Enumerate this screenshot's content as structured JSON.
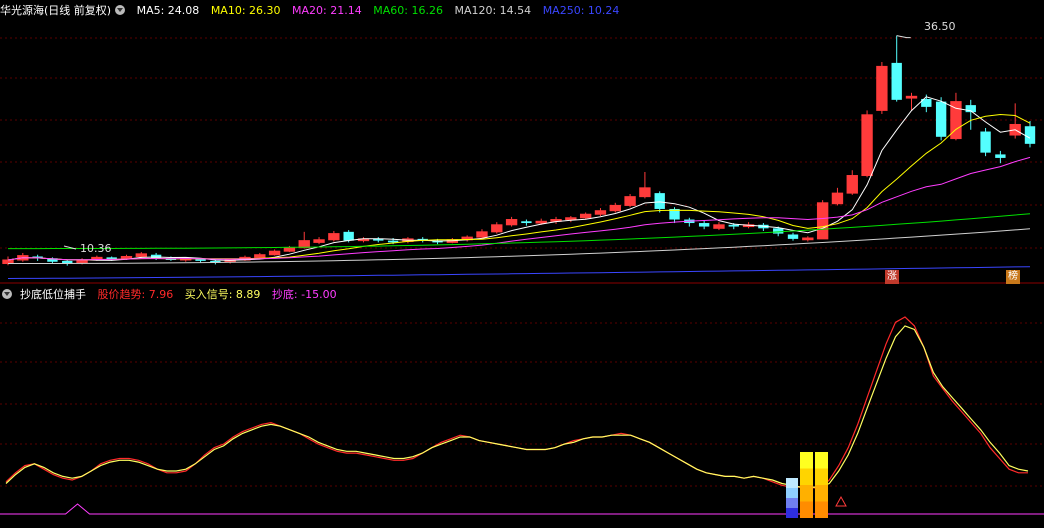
{
  "main_header": {
    "title": "华光源海(日线 前复权)",
    "items": [
      {
        "label": "MA5: 24.08",
        "color": "#ffffff"
      },
      {
        "label": "MA10: 26.30",
        "color": "#ffff00"
      },
      {
        "label": "MA20: 21.14",
        "color": "#ff3dff"
      },
      {
        "label": "MA60: 16.26",
        "color": "#00e000"
      },
      {
        "label": "MA120: 14.54",
        "color": "#d0d0d0"
      },
      {
        "label": "MA250: 10.24",
        "color": "#3a46ff"
      }
    ]
  },
  "sub_header": {
    "title": "抄底低位捕手",
    "items": [
      {
        "label": "股价趋势: 7.96",
        "color": "#ff2a2a"
      },
      {
        "label": "买入信号: 8.89",
        "color": "#ffff60"
      },
      {
        "label": "抄底: -15.00",
        "color": "#ff3dff"
      }
    ]
  },
  "annotations": {
    "high": "36.50",
    "low": "10.36"
  },
  "tags": [
    {
      "text": "涨",
      "bg": "#c0392b"
    },
    {
      "text": "榜",
      "bg": "#c8781a"
    }
  ],
  "colors": {
    "up": "#ff3b3b",
    "down": "#54ffff",
    "grid": "#5a0000",
    "bg": "#000000"
  },
  "chart_data": [
    {
      "type": "candlestick",
      "note": "daily candles, price axis",
      "candles": [
        {
          "o": 10.6,
          "c": 11.0,
          "h": 11.4,
          "l": 10.4
        },
        {
          "o": 11.0,
          "c": 11.5,
          "h": 11.8,
          "l": 10.8
        },
        {
          "o": 11.4,
          "c": 11.2,
          "h": 11.6,
          "l": 10.9
        },
        {
          "o": 11.2,
          "c": 10.8,
          "h": 11.3,
          "l": 10.6
        },
        {
          "o": 10.9,
          "c": 10.6,
          "h": 11.0,
          "l": 10.36
        },
        {
          "o": 10.7,
          "c": 11.0,
          "h": 11.2,
          "l": 10.5
        },
        {
          "o": 11.0,
          "c": 11.3,
          "h": 11.5,
          "l": 10.9
        },
        {
          "o": 11.3,
          "c": 11.1,
          "h": 11.4,
          "l": 10.9
        },
        {
          "o": 11.2,
          "c": 11.4,
          "h": 11.6,
          "l": 11.0
        },
        {
          "o": 11.4,
          "c": 11.7,
          "h": 11.9,
          "l": 11.2
        },
        {
          "o": 11.6,
          "c": 11.2,
          "h": 11.8,
          "l": 11.0
        },
        {
          "o": 11.2,
          "c": 11.0,
          "h": 11.4,
          "l": 10.9
        },
        {
          "o": 11.0,
          "c": 11.2,
          "h": 11.3,
          "l": 10.8
        },
        {
          "o": 11.1,
          "c": 10.9,
          "h": 11.2,
          "l": 10.7
        },
        {
          "o": 10.9,
          "c": 10.7,
          "h": 11.0,
          "l": 10.5
        },
        {
          "o": 10.8,
          "c": 11.0,
          "h": 11.1,
          "l": 10.6
        },
        {
          "o": 11.0,
          "c": 11.3,
          "h": 11.5,
          "l": 10.9
        },
        {
          "o": 11.3,
          "c": 11.6,
          "h": 11.8,
          "l": 11.2
        },
        {
          "o": 11.6,
          "c": 12.0,
          "h": 12.2,
          "l": 11.5
        },
        {
          "o": 12.0,
          "c": 12.4,
          "h": 12.6,
          "l": 11.9
        },
        {
          "o": 12.4,
          "c": 13.2,
          "h": 14.2,
          "l": 12.3
        },
        {
          "o": 13.0,
          "c": 13.3,
          "h": 13.6,
          "l": 12.8
        },
        {
          "o": 13.3,
          "c": 14.0,
          "h": 14.3,
          "l": 13.1
        },
        {
          "o": 14.2,
          "c": 13.2,
          "h": 14.4,
          "l": 13.0
        },
        {
          "o": 13.2,
          "c": 13.4,
          "h": 13.6,
          "l": 13.0
        },
        {
          "o": 13.4,
          "c": 13.2,
          "h": 13.6,
          "l": 13.0
        },
        {
          "o": 13.2,
          "c": 13.0,
          "h": 13.5,
          "l": 12.8
        },
        {
          "o": 13.1,
          "c": 13.4,
          "h": 13.6,
          "l": 12.9
        },
        {
          "o": 13.4,
          "c": 13.2,
          "h": 13.6,
          "l": 13.0
        },
        {
          "o": 13.2,
          "c": 13.0,
          "h": 13.4,
          "l": 12.8
        },
        {
          "o": 13.0,
          "c": 13.3,
          "h": 13.5,
          "l": 12.9
        },
        {
          "o": 13.3,
          "c": 13.6,
          "h": 13.8,
          "l": 13.1
        },
        {
          "o": 13.6,
          "c": 14.2,
          "h": 14.5,
          "l": 13.5
        },
        {
          "o": 14.2,
          "c": 15.0,
          "h": 15.3,
          "l": 14.0
        },
        {
          "o": 15.0,
          "c": 15.6,
          "h": 15.9,
          "l": 14.8
        },
        {
          "o": 15.4,
          "c": 15.2,
          "h": 15.6,
          "l": 14.9
        },
        {
          "o": 15.2,
          "c": 15.4,
          "h": 15.7,
          "l": 15.0
        },
        {
          "o": 15.4,
          "c": 15.6,
          "h": 15.9,
          "l": 15.1
        },
        {
          "o": 15.6,
          "c": 15.8,
          "h": 16.0,
          "l": 15.3
        },
        {
          "o": 15.8,
          "c": 16.2,
          "h": 16.4,
          "l": 15.6
        },
        {
          "o": 16.2,
          "c": 16.6,
          "h": 16.9,
          "l": 16.0
        },
        {
          "o": 16.6,
          "c": 17.2,
          "h": 17.5,
          "l": 16.4
        },
        {
          "o": 17.2,
          "c": 18.2,
          "h": 18.5,
          "l": 17.0
        },
        {
          "o": 18.2,
          "c": 19.2,
          "h": 21.0,
          "l": 18.0
        },
        {
          "o": 18.6,
          "c": 16.8,
          "h": 18.8,
          "l": 16.4
        },
        {
          "o": 16.8,
          "c": 15.6,
          "h": 17.0,
          "l": 15.2
        },
        {
          "o": 15.6,
          "c": 15.2,
          "h": 15.8,
          "l": 14.8
        },
        {
          "o": 15.2,
          "c": 14.8,
          "h": 15.5,
          "l": 14.5
        },
        {
          "o": 14.6,
          "c": 15.0,
          "h": 15.3,
          "l": 14.4
        },
        {
          "o": 15.0,
          "c": 14.8,
          "h": 15.2,
          "l": 14.5
        },
        {
          "o": 14.8,
          "c": 15.0,
          "h": 15.3,
          "l": 14.6
        },
        {
          "o": 15.0,
          "c": 14.6,
          "h": 15.2,
          "l": 14.3
        },
        {
          "o": 14.6,
          "c": 14.0,
          "h": 14.8,
          "l": 13.7
        },
        {
          "o": 13.9,
          "c": 13.4,
          "h": 14.1,
          "l": 13.2
        },
        {
          "o": 13.3,
          "c": 13.5,
          "h": 13.7,
          "l": 13.1
        },
        {
          "o": 13.4,
          "c": 17.5,
          "h": 17.8,
          "l": 13.4
        },
        {
          "o": 17.4,
          "c": 18.6,
          "h": 19.2,
          "l": 17.2
        },
        {
          "o": 18.6,
          "c": 20.6,
          "h": 21.2,
          "l": 18.4
        },
        {
          "o": 20.6,
          "c": 27.5,
          "h": 28.0,
          "l": 20.4
        },
        {
          "o": 28.0,
          "c": 33.0,
          "h": 33.5,
          "l": 27.6
        },
        {
          "o": 33.4,
          "c": 29.2,
          "h": 36.5,
          "l": 29.0
        },
        {
          "o": 29.4,
          "c": 29.6,
          "h": 30.0,
          "l": 28.0
        },
        {
          "o": 29.3,
          "c": 28.4,
          "h": 29.8,
          "l": 27.8
        },
        {
          "o": 29.0,
          "c": 25.0,
          "h": 29.5,
          "l": 24.6
        },
        {
          "o": 24.8,
          "c": 29.0,
          "h": 30.0,
          "l": 24.6
        },
        {
          "o": 28.6,
          "c": 27.8,
          "h": 29.2,
          "l": 25.8
        },
        {
          "o": 25.6,
          "c": 23.2,
          "h": 26.0,
          "l": 22.8
        },
        {
          "o": 23.0,
          "c": 22.6,
          "h": 23.4,
          "l": 22.0
        },
        {
          "o": 25.2,
          "c": 26.4,
          "h": 28.8,
          "l": 24.8
        },
        {
          "o": 26.2,
          "c": 24.2,
          "h": 26.8,
          "l": 23.8
        }
      ],
      "ma5_last": 24.08,
      "ma10_last": 26.3,
      "ma20_last": 21.14,
      "ma60_last": 16.26,
      "ma120_last": 14.54,
      "ma250_last": 10.24,
      "ylim": [
        8.5,
        38.5
      ]
    },
    {
      "type": "line",
      "note": "oscillator panel",
      "series": [
        {
          "name": "股价趋势",
          "color": "#ff2a2a",
          "values": [
            3,
            8,
            12,
            13,
            10,
            7,
            5,
            4,
            6,
            9,
            13,
            15,
            16,
            16,
            15,
            13,
            10,
            8,
            8,
            9,
            13,
            18,
            22,
            24,
            28,
            31,
            33,
            35,
            36,
            34,
            32,
            30,
            27,
            24,
            22,
            20,
            19,
            19,
            18,
            17,
            16,
            15,
            15,
            16,
            19,
            22,
            25,
            27,
            29,
            28,
            26,
            25,
            24,
            23,
            22,
            21,
            21,
            21,
            22,
            24,
            26,
            27,
            28,
            28,
            29,
            30,
            29,
            27,
            25,
            22,
            19,
            16,
            13,
            10,
            8,
            7,
            6,
            6,
            5,
            6,
            5,
            3,
            1,
            0,
            0,
            0,
            -1,
            4,
            12,
            22,
            35,
            50,
            65,
            80,
            92,
            95,
            90,
            78,
            62,
            55,
            48,
            42,
            36,
            30,
            22,
            16,
            10,
            8,
            8
          ]
        },
        {
          "name": "买入信号",
          "color": "#ffff60",
          "values": [
            2,
            7,
            11,
            13,
            11,
            8,
            6,
            5,
            6,
            9,
            12,
            14,
            15,
            15,
            14,
            12,
            10,
            9,
            9,
            10,
            13,
            17,
            21,
            23,
            27,
            30,
            32,
            34,
            35,
            34,
            32,
            30,
            28,
            25,
            23,
            21,
            20,
            20,
            19,
            18,
            17,
            16,
            16,
            17,
            19,
            22,
            24,
            26,
            28,
            28,
            26,
            25,
            24,
            23,
            22,
            21,
            21,
            21,
            22,
            24,
            25,
            27,
            28,
            28,
            29,
            29,
            29,
            27,
            25,
            22,
            19,
            16,
            13,
            10,
            8,
            7,
            6,
            6,
            5,
            6,
            5,
            4,
            2,
            1,
            0,
            0,
            0,
            2,
            9,
            18,
            30,
            44,
            58,
            72,
            84,
            90,
            88,
            78,
            64,
            56,
            50,
            44,
            38,
            32,
            25,
            19,
            12,
            10,
            9
          ]
        },
        {
          "name": "抄底",
          "color": "#ff3dff",
          "baseline_value": -15,
          "pulses": [
            {
              "at": 0.07,
              "height": 8
            }
          ]
        }
      ],
      "signal_bars": [
        {
          "group": "left",
          "segments": [
            "#2e2ee0",
            "#6f7ff0",
            "#8fcfff",
            "#bfe9ff"
          ]
        },
        {
          "group": "mid",
          "segments": [
            "#ff8c00",
            "#ffb000",
            "#ffd400",
            "#ffff20"
          ]
        },
        {
          "group": "right",
          "segments": [
            "#ff8c00",
            "#ffb000",
            "#ffd400",
            "#ffff20"
          ]
        }
      ]
    }
  ]
}
